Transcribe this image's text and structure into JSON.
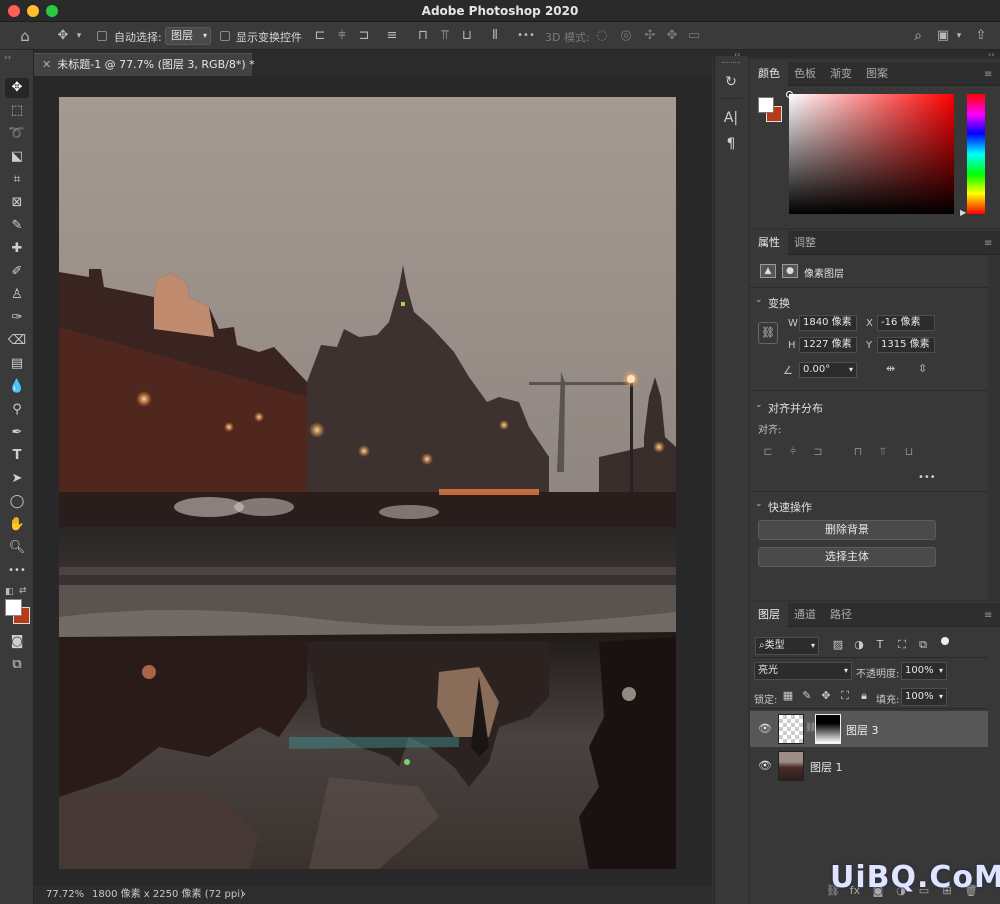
{
  "app_title": "Adobe Photoshop 2020",
  "options_bar": {
    "auto_select_label": "自动选择:",
    "auto_select_value": "图层",
    "show_transform_label": "显示变换控件",
    "more": "•••",
    "mode_3d_label": "3D 模式:"
  },
  "document": {
    "tab_label": "未标题-1 @ 77.7% (图层 3, RGB/8*) *",
    "zoom": "77.72%",
    "doc_info": "1800 像素 x 2250 像素 (72 ppi)",
    "status_arrow": "›"
  },
  "color_panel": {
    "tabs": [
      "颜色",
      "色板",
      "渐变",
      "图案"
    ],
    "foreground": "#ffffff",
    "background": "#b83a17"
  },
  "properties_panel": {
    "tabs": [
      "属性",
      "调整"
    ],
    "layer_type": "像素图层",
    "transform_title": "变换",
    "w_label": "W",
    "w_value": "1840 像素",
    "x_label": "X",
    "x_value": "-16 像素",
    "h_label": "H",
    "h_value": "1227 像素",
    "y_label": "Y",
    "y_value": "1315 像素",
    "angle_value": "0.00°",
    "align_title": "对齐并分布",
    "align_label": "对齐:",
    "more": "•••",
    "quick_actions_title": "快速操作",
    "remove_bg_label": "删除背景",
    "select_subject_label": "选择主体"
  },
  "layers_panel": {
    "tabs": [
      "图层",
      "通道",
      "路径"
    ],
    "filter_label": "类型",
    "blend_mode": "亮光",
    "opacity_label": "不透明度:",
    "opacity_value": "100%",
    "lock_label": "锁定:",
    "fill_label": "填充:",
    "fill_value": "100%",
    "layers": [
      {
        "name": "图层 3",
        "selected": true
      },
      {
        "name": "图层 1",
        "selected": false
      }
    ]
  },
  "watermark": "UiBQ.CoM"
}
